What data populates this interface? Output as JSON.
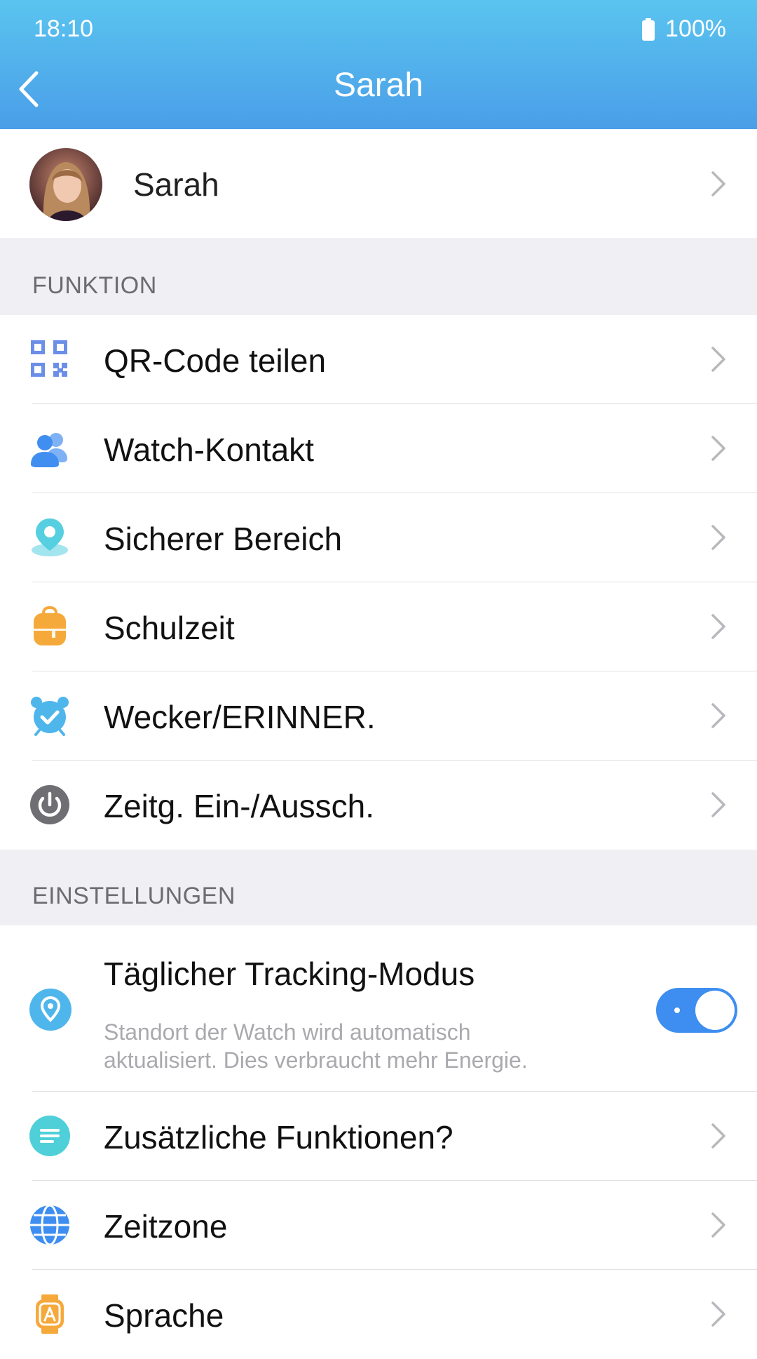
{
  "status_bar": {
    "time": "18:10",
    "battery": "100%"
  },
  "header": {
    "title": "Sarah"
  },
  "profile": {
    "name": "Sarah"
  },
  "sections": {
    "funktion": {
      "title": "FUNKTION",
      "items": [
        {
          "label": "QR-Code teilen",
          "icon": "qr-code-icon"
        },
        {
          "label": "Watch-Kontakt",
          "icon": "contacts-icon"
        },
        {
          "label": "Sicherer Bereich",
          "icon": "location-pin-icon"
        },
        {
          "label": "Schulzeit",
          "icon": "backpack-icon"
        },
        {
          "label": "Wecker/ERINNER.",
          "icon": "alarm-clock-icon"
        },
        {
          "label": "Zeitg. Ein-/Aussch.",
          "icon": "power-icon"
        }
      ]
    },
    "einstellungen": {
      "title": "EINSTELLUNGEN",
      "tracking": {
        "label": "Täglicher Tracking-Modus",
        "sub1": "Standort der Watch wird automatisch",
        "sub2": "aktualisiert. Dies verbraucht mehr Energie.",
        "enabled": true
      },
      "items": [
        {
          "label": "Zusätzliche Funktionen?",
          "icon": "list-icon"
        },
        {
          "label": "Zeitzone",
          "icon": "globe-icon"
        },
        {
          "label": "Sprache",
          "icon": "language-watch-icon"
        }
      ]
    }
  },
  "colors": {
    "header_top": "#5ac4ef",
    "header_bottom": "#4a9ee8",
    "toggle_on": "#3d8ef0",
    "qr": "#6b8fe8",
    "contacts": "#3f8ef0",
    "location": "#56cfe0",
    "backpack": "#f6a93b",
    "alarm": "#4fb6ec",
    "power": "#6e6e73",
    "list": "#4fd0d8",
    "globe": "#3d8ef0",
    "language": "#f6a93b"
  }
}
